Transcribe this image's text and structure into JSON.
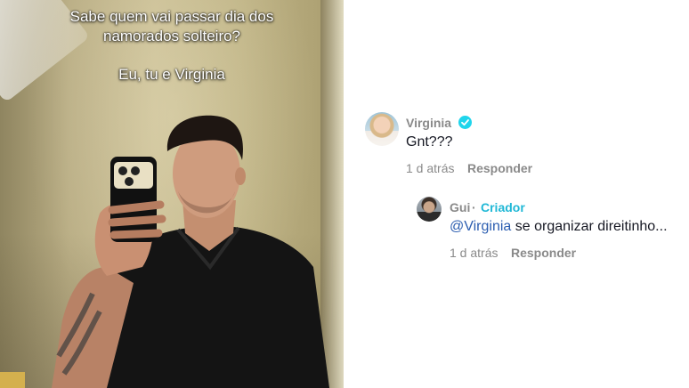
{
  "video": {
    "caption_line1": "Sabe quem vai passar dia dos",
    "caption_line2": "namorados solteiro?",
    "caption_line3": "Eu, tu e Virginia"
  },
  "comments": [
    {
      "username": "Virginia",
      "verified": true,
      "text": "Gnt???",
      "time": "1 d atrás",
      "reply_label": "Responder"
    },
    {
      "username": "Gui",
      "separator": "·",
      "badge": "Criador",
      "mention": "@Virginia",
      "text": " se organizar direitinho...",
      "time": "1 d atrás",
      "reply_label": "Responder"
    }
  ],
  "colors": {
    "verified": "#20d5ec",
    "creator_badge": "#20b8d6",
    "mention": "#2b5db0",
    "meta_text": "#8a8a8a"
  }
}
